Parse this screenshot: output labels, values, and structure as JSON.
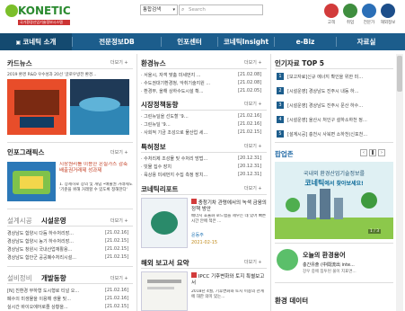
{
  "header": {
    "logo_name": "KONETIC",
    "logo_sub": "국가환경산업기술정보시스템",
    "search_scope": "통합검색",
    "search_placeholder": "Search",
    "quick": [
      {
        "label": "고객",
        "color": "#d23b3b"
      },
      {
        "label": "취업",
        "color": "#3f8e3f"
      },
      {
        "label": "전문가",
        "color": "#2b6fb7"
      },
      {
        "label": "해외정보",
        "color": "#1d4e8a"
      }
    ]
  },
  "nav": {
    "items": [
      "코네틱 소개",
      "전문정보DB",
      "인포센터",
      "코네틱Insight",
      "e-Biz",
      "자료실"
    ]
  },
  "col1": {
    "cardnews_title": "카드뉴스",
    "cardnews_more": "더보기 +",
    "cardnews_caption": "2019 환경 R&D 우수성과 20선 '글로우방전 환경...",
    "infographic_title": "인포그래픽스",
    "infographic_more": "더보기 +",
    "infographic_text": "시장원리를 이용한 온실가스 감축 배출권거래제 성과제",
    "infographic_body": "1. 상세히로 장의 및 개념 •배출권 거래제도 '기준을 위해 거래할 수 있도록 정해한다'",
    "facility_tab1": "설계시공",
    "facility_tab2": "시설운영",
    "facility_more": "더보기 +",
    "facility_items": [
      {
        "text": "경상남도 함양시 다듬 하수처리장...",
        "date": "[21.02.16]"
      },
      {
        "text": "경상남도 함양시 농기 하수처리장...",
        "date": "[21.02.15]"
      },
      {
        "text": "경상남도 창원시 국내산업재활용...",
        "date": "[21.02.15]"
      },
      {
        "text": "경상남도 함안군 공공폐수처리시설...",
        "date": "[21.02.15]"
      }
    ],
    "invest_tab1": "설비정비",
    "invest_tab2": "개발동향",
    "invest_more": "더보기 +",
    "invest_items": [
      {
        "text": "[N] 친환경 부하형 도시형로 티널 오...",
        "date": "[21.02.16]"
      },
      {
        "text": "폐수의 미생물을 이용해 생물 및...",
        "date": "[21.02.16]"
      },
      {
        "text": "실시간 바이오에어로졸 상황을...",
        "date": "[21.02.15]"
      }
    ]
  },
  "col2": {
    "news_title": "환경뉴스",
    "news_more": "더보기 +",
    "news_items": [
      {
        "text": "· 서울시, 자객 맞춤 미세먼지 ...",
        "date": "[21.02.08]"
      },
      {
        "text": "· 수도권대기환경청, 악취기술지원 ...",
        "date": "[21.02.08]"
      },
      {
        "text": "· 환경부, 올해 상하수도시설 확...",
        "date": "[21.02.05]"
      }
    ],
    "market_title": "시장정책동향",
    "market_more": "더보기 +",
    "market_items": [
      {
        "text": "· 그린뉴딜을 선도할 '9…",
        "date": "[21.02.16]"
      },
      {
        "text": "· 그린뉴딜 '9…",
        "date": "[21.02.16]"
      },
      {
        "text": "· 사회적 기금 조성으로 물산업 세…",
        "date": "[21.02.15]"
      }
    ],
    "patent_title": "특허정보",
    "patent_more": "더보기 +",
    "patent_items": [
      {
        "text": "· 수처리제 조성물 및 수처리 방법…",
        "date": "[20.12.31]"
      },
      {
        "text": "· 빗물 집수 장치",
        "date": "[20.12.31]"
      },
      {
        "text": "· 육상용 미세먼지 수집 측정 장치…",
        "date": "[20.12.31]"
      }
    ],
    "report_title": "코네틱리포트",
    "report_more": "더보기 +",
    "report_headline": "충청기차 관령에서의 녹색 금융의 정책 방안",
    "report_body": "배너지 효율화 로드맵을 세우는 데 있어 빠른 시간 안에 적은 ...",
    "report_author": "윤동주",
    "report_date": "2021-02-15",
    "overseas_title": "해외 보고서 요약",
    "overseas_more": "더보기 +",
    "overseas_headline": "IPCC 기후변화와 토지 특별보고서",
    "overseas_body": "2018년 4월, 기후변화와 토지 이용의 관계에 대한 의미 있는..."
  },
  "col3": {
    "top5_title": "인기자료 TOP 5",
    "top5_items": [
      "[보고자료]신규 에너지 확인을 위한 미…",
      "[시설운영] 경상남도 진주시 내동 하…",
      "[시설운영] 경상남도 진주시 문산 하수…",
      "[시설운영] 울산시 처인구 설하소하천 정…",
      "[설계시공] 충천시 사북면 소하천(신포천…"
    ],
    "popup_title": "팝업존",
    "popup_line1": "국내외 환경산업기술정보를",
    "popup_brand": "코네틱",
    "popup_line2": "에서 찾아보세요!",
    "popup_page": "1 / 3",
    "today_title": "오늘의 환경용어",
    "today_term": "충간유출 (中間流出 inte...",
    "today_body": "강우 중에 침투된 물이 지표면...",
    "envdata_title": "환경 데이터"
  }
}
